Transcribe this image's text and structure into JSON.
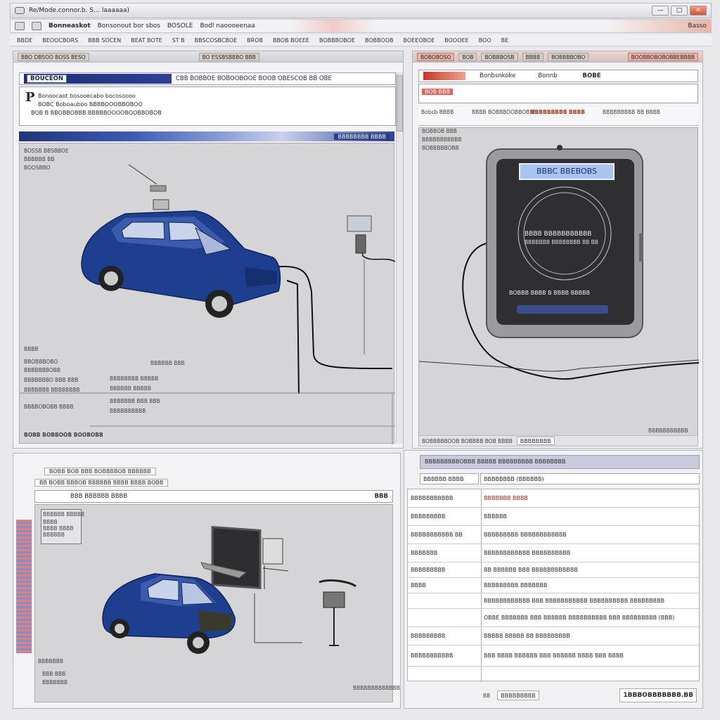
{
  "window": {
    "title": "Re/Mode.connor.b. S… laaaaaa)",
    "controls": [
      "—",
      "□",
      "✕"
    ]
  },
  "toolbar": {
    "items": [
      "Bonneaskot",
      "Bonsonout bor sbos",
      "BOSOLE",
      "Bodl naoooeenaa",
      "Basso"
    ]
  },
  "menubar": {
    "items": [
      "BBDE",
      "BEOOCBORS",
      "BBB SOCEN",
      "BEAT BOTE",
      "ST B",
      "BBSCOSBCBOE",
      "BROB",
      "BBOB BOEEE",
      "BOBBBOBOE",
      "BOBBOOB",
      "BOEEOBOE",
      "BOOOEE",
      "BOO",
      "BE"
    ]
  },
  "top_left": {
    "chips": [
      "BBO DBSOO BOSS BESO",
      "BO ESSBSBBBO BBB"
    ],
    "nav_tag": "BOUCEON",
    "nav_title": "CBB BOBBOE BOBOOBOOE BOOB OBESCOB BB OBE",
    "info_initial": "P",
    "info_lines": [
      "Bonoocaot bosooecabo bocosoooo",
      "BOBC Boboauboo BBBBOOOBBOBOO",
      "BOB B BBOBBOBBB BBBBBOOOOBOOBBOBOB"
    ],
    "bluebar_text": "BBBBBBBB BBBB",
    "diagram_labels": [
      "BOSSB BBSBBOE",
      "BBBBBB BB",
      "BOOSBBO"
    ],
    "side_texts": [
      "BBBB",
      "BBOBBBOBO",
      "BBBBBBBOBB",
      "BBBBBBBO BBB BBB",
      "BBBBBBB BBBBBBBB",
      "BBBBOBOBB BBBB"
    ],
    "mid_texts": [
      "BBBBBB BBB",
      "BBBBBBBB BBBBB",
      "BBBBBB BBBBB",
      "BBBBBBB BBB BBB",
      "BBBBBBBBBB"
    ],
    "footer_text": "BOBB BOBBOOB BOOBOBB"
  },
  "top_right": {
    "chips": [
      "BOBOBOSO",
      "BOB",
      "BOBBBOSB",
      "BBBB",
      "BOBBBBOBO",
      "BOOBBOBOBOBBEBBBB"
    ],
    "header_items": [
      "Bonbsnkoke",
      "Bonnb",
      "BOBE"
    ],
    "tab_a": "BOB BBB",
    "sub_headers": [
      "Bobcb BBBB",
      "BBBB BOBBBOOBBOBBB",
      "BBBBBBBBB BBBB",
      "BBBBBBBBB BB BBBB"
    ],
    "left_labels": [
      "BOBBOB BBB",
      "BBBBBBBBBBB",
      "BOBBBBBOBB"
    ],
    "device_title": "BBBC BBEBOBS",
    "device_lines": [
      "BBBB BBBBBBBBBBB",
      "BBBBBBB BBBBBBBB BB BB"
    ],
    "device_bottom": "BOBBB BBBB B BBBB BBBBB",
    "footer_text": "BOBBBBBOOB BOBBBB BOB BBBB",
    "footer_field": "BBBBBBBB",
    "corner_text": "BBBBBBBBBBB"
  },
  "bottom_left": {
    "tab1": "BOBB BOB BBB BOBBBBOB BBBBBB",
    "tab2": "BB BOBB BBBOB BBBBBB BBBB BBBB BOBB",
    "nav_title": "BBB BBBBBB BBBB",
    "nav_right": "BBB",
    "inset_title": "BBBBBB BBBBB",
    "inset_lines": [
      "BBBB",
      "BBBB BBBB",
      "BBBBBB"
    ],
    "side_texts": [
      "BBBBBBB",
      "BBB BBB",
      "BBBBBBB"
    ],
    "footer_text": "BBBBBBBBBBBBB"
  },
  "bottom_right": {
    "header": "BBBBBBBBBOBBB BBBBB BBBBBBBBB BBBBBBBB",
    "field_left": "BBBBBB BBBB",
    "field_right": "BBBBBBBB (BBBBBB)",
    "rows": [
      {
        "label": "BBBBBBBBBBB",
        "value": "BBBBBBB BBBB"
      },
      {
        "label": "BBBBBBBBB",
        "value": "BBBBBB"
      },
      {
        "label": "BBBBBBBBBBB BB",
        "value": "BBBBBBBBB BBBBBBBBBBBB"
      },
      {
        "label": "BBBBBBB",
        "value": "BBBBBBBBBBBB BBBBBBBBBB"
      },
      {
        "label": "BBBBBBBBB",
        "value": "BB BBBBBB BBB BBBBBBBBBBBB"
      },
      {
        "label": "BBBB",
        "value": "BBBBBBBBB BBBBBBB"
      },
      {
        "label": "",
        "value": "BBBBBBBBBBBB BBB BBBBBBBBBBB BBBBBBBBBB BBBBBBBBB"
      },
      {
        "label": "",
        "value": "OBBE BBBBBBB BBB BBBBBB BBBBBBBBBB BBB BBBBBBBBB (BBB)"
      },
      {
        "label": "BBBBBBBBB",
        "value": "BBBBB BBBBB BB BBBBBBBBB"
      },
      {
        "label": "BBBBBBBBBBB",
        "value": "BBB BBBB BBBBBB BBB BBBBBB BBBB BBB BBBB"
      }
    ],
    "bottom_values": [
      "BB",
      "BBBBBBBBB"
    ],
    "total_label": "1BBBOBBBBBBB.BB"
  },
  "colors": {
    "accent_blue": "#2f4594",
    "car_blue": "#1e3f8f",
    "accent_red": "#d8532f"
  }
}
